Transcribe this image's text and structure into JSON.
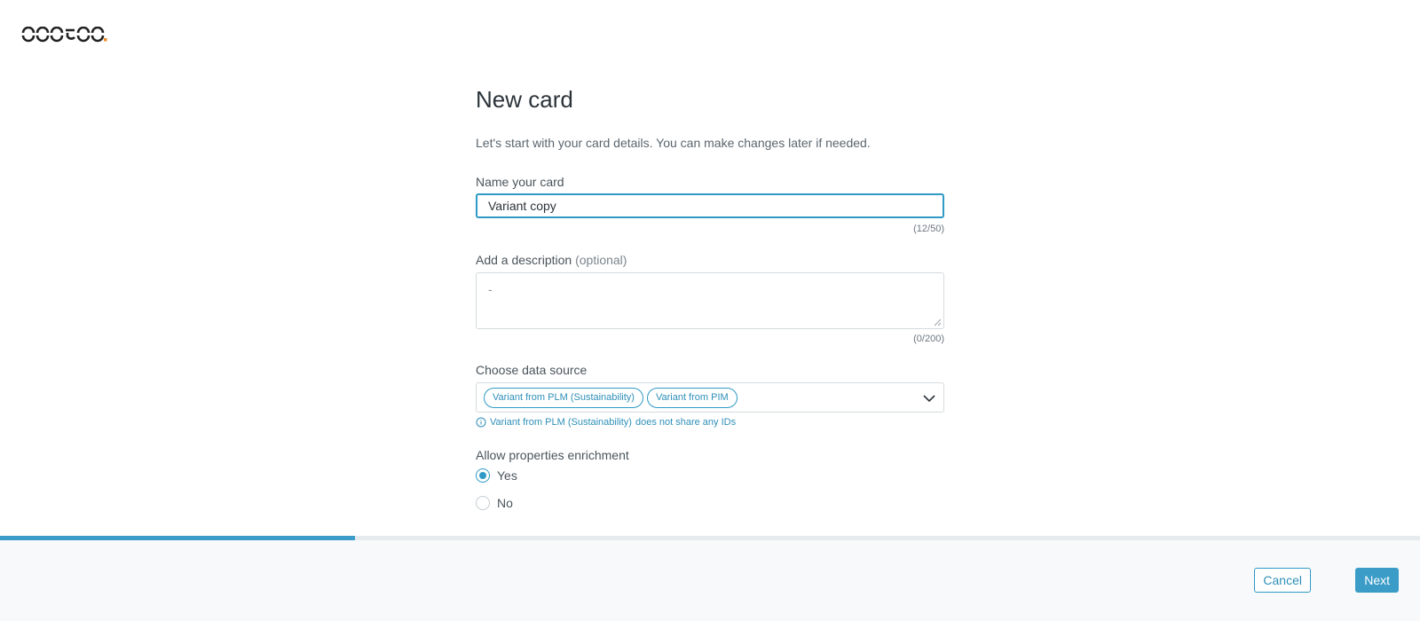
{
  "brand": {
    "logo_text": "ocotoo.",
    "accent": "#f08c2e"
  },
  "form": {
    "title": "New card",
    "subtitle": "Let's start with your card details. You can make changes later if needed.",
    "name": {
      "label": "Name your card",
      "value": "Variant copy",
      "counter": "(12/50)"
    },
    "description": {
      "label": "Add a description",
      "optional": "(optional)",
      "placeholder": "-",
      "value": "",
      "counter": "(0/200)"
    },
    "data_source": {
      "label": "Choose data source",
      "selected": [
        "Variant from PLM (Sustainability)",
        "Variant from PIM"
      ],
      "dropdown_icon": "chevron-down-icon",
      "notice": {
        "icon": "info-icon",
        "strong": "Variant from PLM (Sustainability)",
        "text": "does not share any IDs"
      }
    },
    "enrichment": {
      "label": "Allow properties enrichment",
      "options": [
        {
          "label": "Yes",
          "checked": true
        },
        {
          "label": "No",
          "checked": false
        }
      ]
    }
  },
  "progress": {
    "fraction": 0.25
  },
  "footer": {
    "cancel_label": "Cancel",
    "next_label": "Next"
  },
  "colors": {
    "primary": "#3a9cc7",
    "text": "#2b3339",
    "footer_bg": "#f7f9fa"
  }
}
